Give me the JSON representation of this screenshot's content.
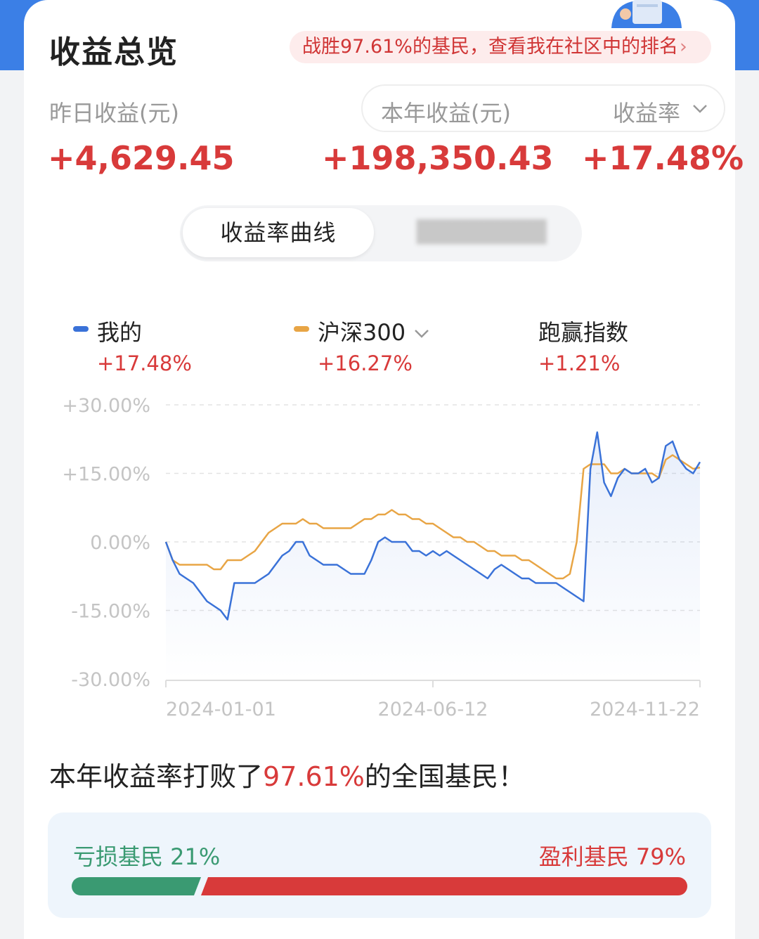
{
  "header": {
    "title": "收益总览",
    "rank_banner": "战胜97.61%的基民，查看我在社区中的排名",
    "rank_banner_chevron": "›"
  },
  "summary": {
    "yesterday_label": "昨日收益(元)",
    "yesterday_value": "+4,629.45",
    "year_label": "本年收益(元)",
    "year_value": "+198,350.43",
    "rate_label": "收益率",
    "rate_value": "+17.48%"
  },
  "tabs": {
    "active": "收益率曲线"
  },
  "legend": [
    {
      "name": "我的",
      "value": "+17.48%",
      "color": "#3a72d8"
    },
    {
      "name": "沪深300",
      "value": "+16.27%",
      "color": "#e8a545"
    },
    {
      "name": "跑赢指数",
      "value": "+1.21%"
    }
  ],
  "colors": {
    "accent_red": "#d83a3a",
    "green": "#3a9a72",
    "mine_line": "#3a72d8",
    "index_line": "#e8a545"
  },
  "chart_data": {
    "type": "line",
    "ylabels": [
      "+30.00%",
      "+15.00%",
      "0.00%",
      "-15.00%",
      "-30.00%"
    ],
    "xlabels": [
      "2024-01-01",
      "2024-06-12",
      "2024-11-22"
    ],
    "ylim": [
      -30,
      30
    ],
    "grid": true,
    "series": [
      {
        "name": "我的",
        "color": "#3a72d8",
        "values": [
          0,
          -4,
          -7,
          -8,
          -9,
          -11,
          -13,
          -14,
          -15,
          -17,
          -9,
          -9,
          -9,
          -9,
          -8,
          -7,
          -5,
          -3,
          -2,
          0,
          0,
          -3,
          -4,
          -5,
          -5,
          -5,
          -6,
          -7,
          -7,
          -7,
          -4,
          0,
          1,
          0,
          0,
          0,
          -2,
          -2,
          -3,
          -2,
          -3,
          -2,
          -3,
          -4,
          -5,
          -6,
          -7,
          -8,
          -6,
          -5,
          -6,
          -7,
          -8,
          -8,
          -9,
          -9,
          -9,
          -9,
          -10,
          -11,
          -12,
          -13,
          16,
          24,
          13,
          10,
          14,
          16,
          15,
          15,
          16,
          13,
          14,
          21,
          22,
          18,
          16,
          15,
          17.48
        ]
      },
      {
        "name": "沪深300",
        "color": "#e8a545",
        "values": [
          0,
          -4,
          -5,
          -5,
          -5,
          -5,
          -5,
          -6,
          -6,
          -4,
          -4,
          -4,
          -3,
          -2,
          0,
          2,
          3,
          4,
          4,
          4,
          5,
          4,
          4,
          3,
          3,
          3,
          3,
          3,
          4,
          5,
          5,
          6,
          6,
          7,
          6,
          6,
          5,
          5,
          4,
          4,
          3,
          2,
          1,
          1,
          0,
          0,
          -1,
          -2,
          -2,
          -3,
          -3,
          -3,
          -4,
          -4,
          -5,
          -6,
          -7,
          -8,
          -8,
          -7,
          0,
          16,
          17,
          17,
          17,
          15,
          15,
          16,
          15,
          15,
          15,
          15,
          14,
          18,
          19,
          18,
          17,
          16,
          16.27
        ]
      }
    ]
  },
  "beat": {
    "prefix": "本年收益率打败了",
    "percent": "97.61%",
    "suffix": "的全国基民！"
  },
  "distribution": {
    "loss_label": "亏损基民 21%",
    "gain_label": "盈利基民 79%",
    "loss_ratio": 0.21
  }
}
